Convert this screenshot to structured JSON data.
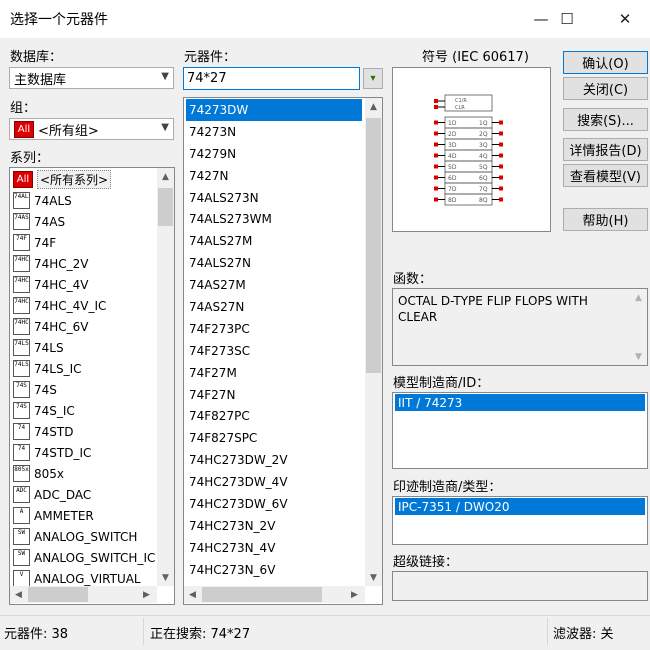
{
  "window": {
    "title": "选择一个元器件",
    "minimize": "—",
    "maximize": "☐",
    "close": "✕"
  },
  "database": {
    "label": "数据库：",
    "value": "主数据库"
  },
  "group": {
    "label": "组：",
    "value": "<所有组>",
    "icon_text": "All"
  },
  "family": {
    "label": "系列：",
    "items": [
      {
        "icon": "All",
        "label": "<所有系列>",
        "selected": true
      },
      {
        "icon": "74ALS",
        "label": "74ALS"
      },
      {
        "icon": "74AS",
        "label": "74AS"
      },
      {
        "icon": "74F",
        "label": "74F"
      },
      {
        "icon": "74HC",
        "label": "74HC_2V"
      },
      {
        "icon": "74HC",
        "label": "74HC_4V"
      },
      {
        "icon": "74HC",
        "label": "74HC_4V_IC"
      },
      {
        "icon": "74HC",
        "label": "74HC_6V"
      },
      {
        "icon": "74LS",
        "label": "74LS"
      },
      {
        "icon": "74LS",
        "label": "74LS_IC"
      },
      {
        "icon": "74S",
        "label": "74S"
      },
      {
        "icon": "74S",
        "label": "74S_IC"
      },
      {
        "icon": "74",
        "label": "74STD"
      },
      {
        "icon": "74",
        "label": "74STD_IC"
      },
      {
        "icon": "805x",
        "label": "805x"
      },
      {
        "icon": "ADC",
        "label": "ADC_DAC"
      },
      {
        "icon": "A",
        "label": "AMMETER"
      },
      {
        "icon": "SW",
        "label": "ANALOG_SWITCH"
      },
      {
        "icon": "SW",
        "label": "ANALOG_SWITCH_IC"
      },
      {
        "icon": "V",
        "label": "ANALOG_VIRTUAL"
      }
    ]
  },
  "component": {
    "label": "元器件：",
    "search_value": "74*27",
    "filter_icon": "▾",
    "items": [
      "74273DW",
      "74273N",
      "74279N",
      "7427N",
      "74ALS273N",
      "74ALS273WM",
      "74ALS27M",
      "74ALS27N",
      "74AS27M",
      "74AS27N",
      "74F273PC",
      "74F273SC",
      "74F27M",
      "74F27N",
      "74F827PC",
      "74F827SPC",
      "74HC273DW_2V",
      "74HC273DW_4V",
      "74HC273DW_6V",
      "74HC273N_2V",
      "74HC273N_4V",
      "74HC273N_6V"
    ],
    "selected_index": 0
  },
  "symbol": {
    "label": "符号 (IEC 60617)",
    "chip_header": "C1/R",
    "chip_clk": "CLR",
    "pins_left": [
      "1D",
      "2D",
      "3D",
      "4D",
      "5D",
      "6D",
      "7D",
      "8D"
    ],
    "pins_right": [
      "1Q",
      "2Q",
      "3Q",
      "4Q",
      "5Q",
      "6Q",
      "7Q",
      "8Q"
    ]
  },
  "buttons": {
    "ok": "确认(O)",
    "close": "关闭(C)",
    "search": "搜索(S)...",
    "detail": "详情报告(D)",
    "view_model": "查看模型(V)",
    "help": "帮助(H)"
  },
  "function": {
    "label": "函数：",
    "text": "OCTAL D-TYPE FLIP FLOPS WITH CLEAR"
  },
  "model_mfr": {
    "label": "模型制造商/ID：",
    "items": [
      "IIT / 74273"
    ]
  },
  "footprint": {
    "label": "印迹制造商/类型：",
    "items": [
      "IPC-7351 / DWO20"
    ]
  },
  "hyperlink": {
    "label": "超级链接：",
    "value": ""
  },
  "statusbar": {
    "components": "元器件:  38",
    "searching": "正在搜索:  74*27",
    "filter": "滤波器:  关"
  }
}
